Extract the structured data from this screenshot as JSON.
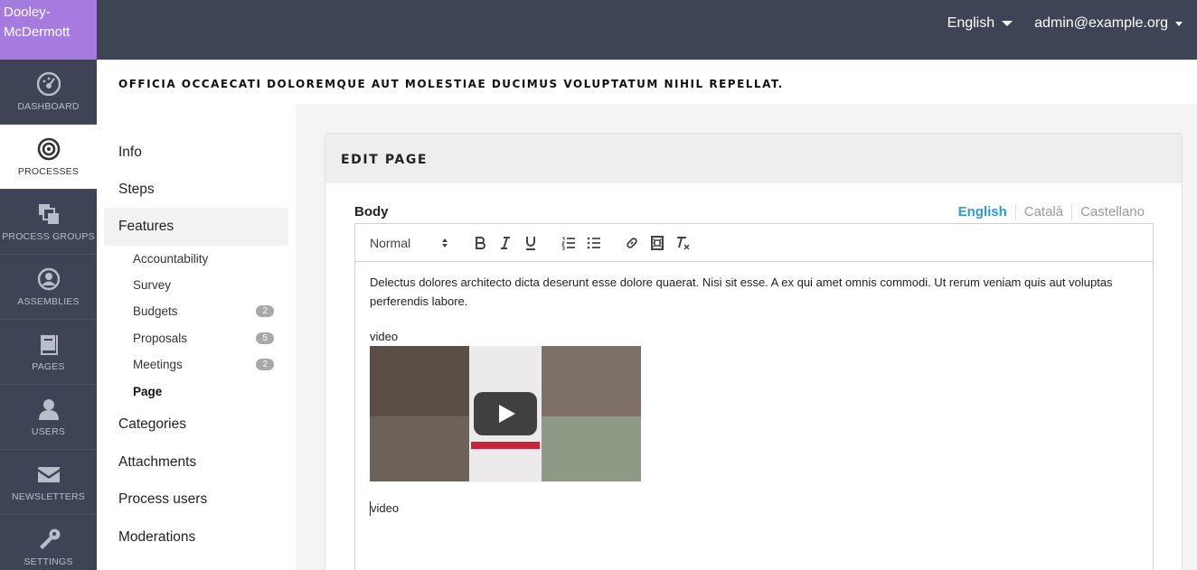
{
  "brand": {
    "line1": "Dooley-",
    "line2": "McDermott"
  },
  "topbar": {
    "language": "English",
    "user": "admin@example.org"
  },
  "nav": [
    {
      "label": "DASHBOARD",
      "icon": "dashboard-icon"
    },
    {
      "label": "PROCESSES",
      "icon": "processes-icon"
    },
    {
      "label": "PROCESS GROUPS",
      "icon": "process-groups-icon"
    },
    {
      "label": "ASSEMBLIES",
      "icon": "assemblies-icon"
    },
    {
      "label": "PAGES",
      "icon": "pages-icon"
    },
    {
      "label": "USERS",
      "icon": "users-icon"
    },
    {
      "label": "NEWSLETTERS",
      "icon": "newsletters-icon"
    },
    {
      "label": "SETTINGS",
      "icon": "settings-icon"
    }
  ],
  "page_title": "OFFICIA OCCAECATI DOLOREMQUE AUT MOLESTIAE DUCIMUS VOLUPTATUM NIHIL REPELLAT.",
  "sub_nav": {
    "info": "Info",
    "steps": "Steps",
    "features": "Features",
    "components": [
      {
        "label": "Accountability",
        "count": ""
      },
      {
        "label": "Survey",
        "count": ""
      },
      {
        "label": "Budgets",
        "count": "2"
      },
      {
        "label": "Proposals",
        "count": "5"
      },
      {
        "label": "Meetings",
        "count": "2"
      },
      {
        "label": "Page",
        "count": ""
      }
    ],
    "categories": "Categories",
    "attachments": "Attachments",
    "process_users": "Process users",
    "moderations": "Moderations"
  },
  "card": {
    "header": "EDIT PAGE",
    "field_label": "Body",
    "languages": [
      "English",
      "Català",
      "Castellano"
    ],
    "active_language": "English"
  },
  "editor": {
    "format": "Normal",
    "toolbar_icons": [
      "bold-icon",
      "italic-icon",
      "underline-icon",
      "ordered-list-icon",
      "bullet-list-icon",
      "link-icon",
      "video-icon",
      "clear-format-icon"
    ],
    "paragraph": "Delectus dolores architecto dicta deserunt esse dolore quaerat. Nisi sit esse. A ex qui amet omnis commodi. Ut rerum veniam quis aut voluptas perferendis labore.",
    "video_label_1": "video",
    "video_label_2": "video"
  },
  "colors": {
    "topbar": "#3e4456",
    "brand": "#a57be0",
    "active_lang": "#2d9bd4"
  }
}
